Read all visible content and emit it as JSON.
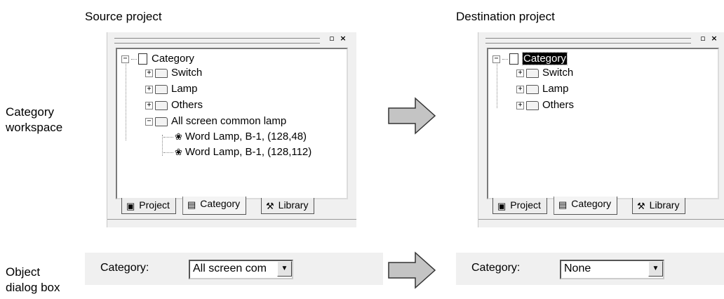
{
  "captions": {
    "source": "Source project",
    "destination": "Destination project",
    "category_workspace": [
      "Category",
      "workspace"
    ],
    "object_dialog": [
      "Object",
      "dialog box"
    ]
  },
  "source_panel": {
    "root": "Category",
    "items": [
      "Switch",
      "Lamp",
      "Others",
      "All screen common lamp"
    ],
    "objects": [
      "Word Lamp, B-1, (128,48)",
      "Word Lamp, B-1, (128,112)"
    ],
    "tabs": [
      "Project",
      "Category",
      "Library"
    ]
  },
  "dest_panel": {
    "root": "Category",
    "items": [
      "Switch",
      "Lamp",
      "Others"
    ],
    "tabs": [
      "Project",
      "Category",
      "Library"
    ]
  },
  "source_dialog": {
    "label": "Category:",
    "value": "All screen com"
  },
  "dest_dialog": {
    "label": "Category:",
    "value": "None"
  },
  "colors": {
    "arrow_fill": "#c4c4c4",
    "selection": "#000000"
  }
}
